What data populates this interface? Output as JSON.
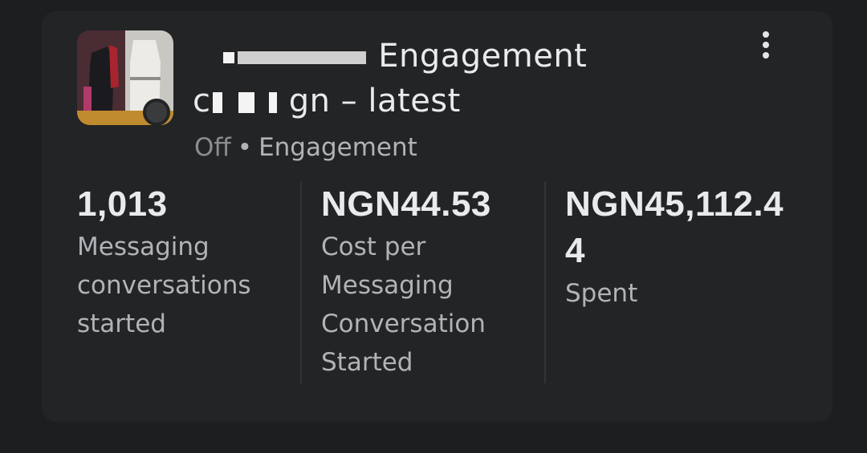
{
  "campaign": {
    "title_line1_visible": "Engagement",
    "title_line2_visible": "gn – latest",
    "title_line2_prefix": "c",
    "status": "Off",
    "separator": "•",
    "objective": "Engagement"
  },
  "metrics": [
    {
      "value": "1,013",
      "label": "Messaging conversations started"
    },
    {
      "value": "NGN44.53",
      "label": "Cost per Messaging Conversation Started"
    },
    {
      "value": "NGN45,112.44",
      "label": "Spent"
    }
  ],
  "icons": {
    "more": "vertical-ellipsis-icon",
    "status": "status-dot-icon"
  },
  "colors": {
    "background": "#1d1e20",
    "card": "#232425",
    "primary_text": "#e9eaed",
    "secondary_text": "#b0b3b8",
    "muted_text": "#8a8d91"
  }
}
